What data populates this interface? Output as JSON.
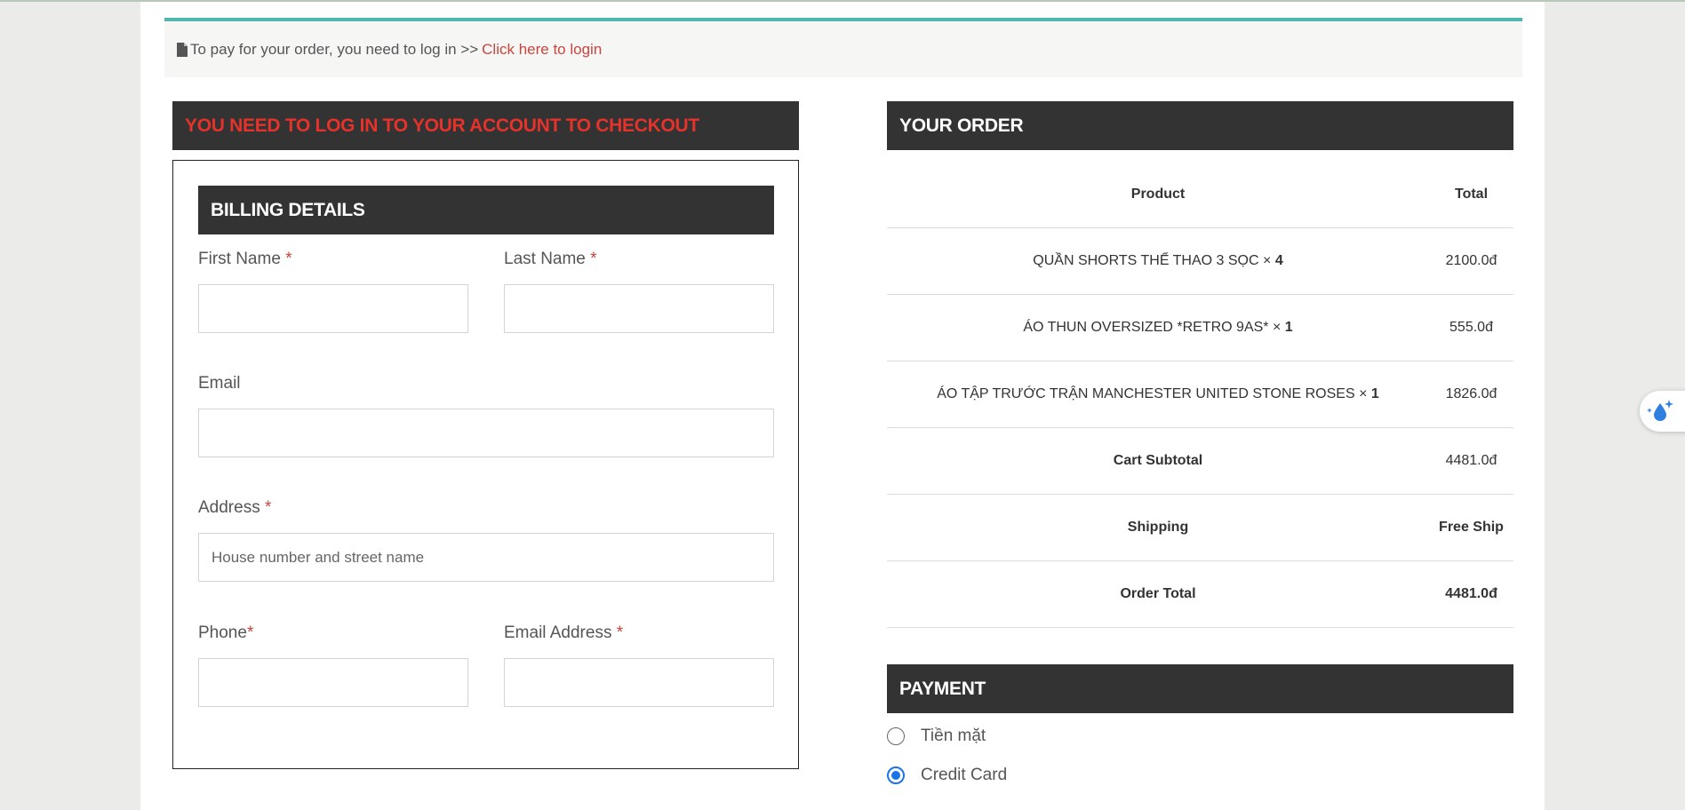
{
  "notice": {
    "text": "To pay for your order, you need to log in >>",
    "link": "Click here to login"
  },
  "login_banner": "YOU NEED TO LOG IN TO YOUR ACCOUNT TO CHECKOUT",
  "billing": {
    "title": "BILLING DETAILS",
    "first_name_label": "First Name",
    "last_name_label": "Last Name",
    "email_label": "Email",
    "address_label": "Address",
    "address_placeholder": "House number and street name",
    "phone_label": "Phone",
    "email_address_label": "Email Address",
    "required_mark": "*"
  },
  "order": {
    "title": "YOUR ORDER",
    "col_product": "Product",
    "col_total": "Total",
    "items": [
      {
        "name": "QUẦN SHORTS THỂ THAO 3 SỌC",
        "times": "×",
        "qty": "4",
        "total": "2100.0đ"
      },
      {
        "name": "ÁO THUN OVERSIZED *RETRO 9AS*",
        "times": "×",
        "qty": "1",
        "total": "555.0đ"
      },
      {
        "name": "ÁO TẬP TRƯỚC TRẬN MANCHESTER UNITED STONE ROSES",
        "times": "×",
        "qty": "1",
        "total": "1826.0đ"
      }
    ],
    "subtotal_label": "Cart Subtotal",
    "subtotal_value": "4481.0đ",
    "shipping_label": "Shipping",
    "shipping_value": "Free Ship",
    "order_total_label": "Order Total",
    "order_total_value": "4481.0đ"
  },
  "payment": {
    "title": "PAYMENT",
    "options": [
      {
        "label": "Tiền mặt",
        "selected": false
      },
      {
        "label": "Credit Card",
        "selected": true
      }
    ]
  },
  "icons": [
    "document-icon",
    "sparkle-drop-icon"
  ],
  "colors": {
    "accent_red": "#c9453e",
    "banner_red": "#e5322b",
    "dark_bar": "#333333",
    "teal_border": "#4fb8ae",
    "radio_blue": "#1a73e8"
  }
}
